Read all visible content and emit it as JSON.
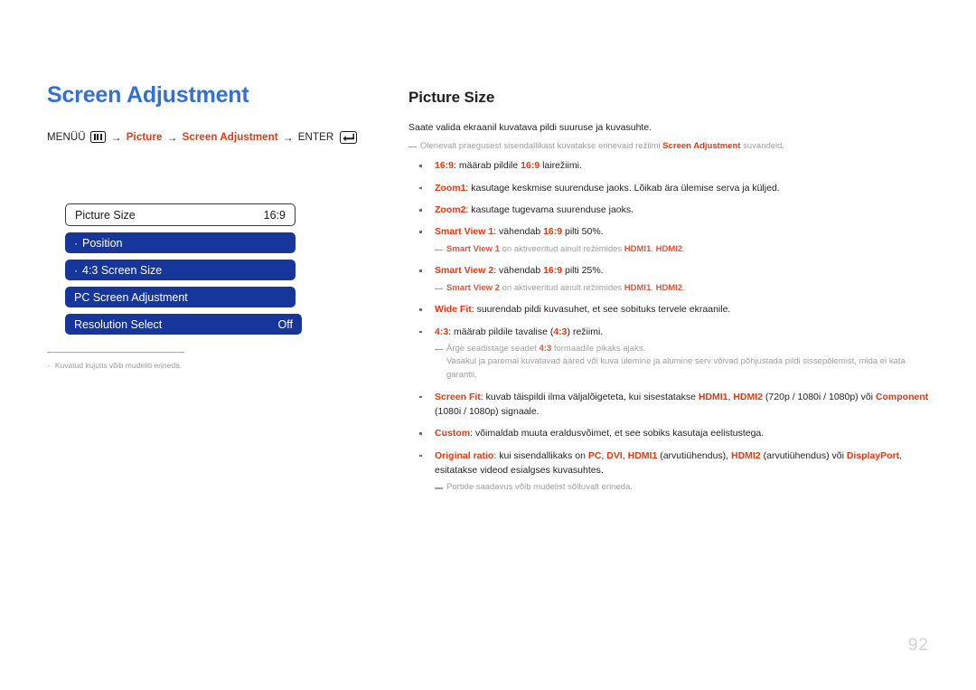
{
  "page": {
    "number": "92",
    "title": "Screen Adjustment"
  },
  "menu_path": {
    "prefix": "MENÜÜ",
    "menu_icon": "menu-key-icon",
    "arrow": "→",
    "item1": "Picture",
    "item2": "Screen Adjustment",
    "enter_label": "ENTER",
    "enter_icon": "enter-key-icon"
  },
  "osd": {
    "rows": [
      {
        "label": "Picture Size",
        "value": "16:9",
        "style": "selected",
        "dot": false
      },
      {
        "label": "Position",
        "value": "",
        "style": "blue",
        "dot": true
      },
      {
        "label": "4:3 Screen Size",
        "value": "",
        "style": "blue",
        "dot": true
      },
      {
        "label": "PC Screen Adjustment",
        "value": "",
        "style": "blue",
        "dot": false
      },
      {
        "label": "Resolution Select",
        "value": "Off",
        "style": "blue wide",
        "dot": false
      }
    ]
  },
  "left_note": {
    "dash": "-",
    "text": "Kuvatud kujutis võib mudeliti erineda."
  },
  "content": {
    "section_title": "Picture Size",
    "intro": "Saate valida ekraanil kuvatava pildi suuruse ja kuvasuhte.",
    "intro_note": {
      "pre": "Olenevalt praegusest sisendallikast kuvatakse erinevaid režiimi ",
      "term": "Screen Adjustment",
      "post": " suvandeid."
    },
    "bullets": [
      {
        "term": "16:9",
        "sep": ": ",
        "pre": "määrab pildile ",
        "term2": "16:9",
        "post": " lairežiimi."
      },
      {
        "term": "Zoom1",
        "sep": ": ",
        "pre": "kasutage keskmise suurenduse jaoks. Lõikab ära ülemise serva ja küljed.",
        "term2": "",
        "post": ""
      },
      {
        "term": "Zoom2",
        "sep": ": ",
        "pre": "kasutage tugevama suurenduse jaoks.",
        "term2": "",
        "post": ""
      },
      {
        "term": "Smart View 1",
        "sep": ": ",
        "pre": "vähendab ",
        "term2": "16:9",
        "post": " pilti 50%.",
        "note": {
          "term": "Smart View 1",
          "mid": " on aktiveeritud ainult režiimides ",
          "term_a": "HDMI1",
          "comma": ", ",
          "term_b": "HDMI2",
          "end": "."
        }
      },
      {
        "term": "Smart View 2",
        "sep": ": ",
        "pre": "vähendab ",
        "term2": "16:9",
        "post": " pilti 25%.",
        "note": {
          "term": "Smart View 2",
          "mid": " on aktiveeritud ainult režiimides ",
          "term_a": "HDMI1",
          "comma": ", ",
          "term_b": "HDMI2",
          "end": "."
        }
      },
      {
        "term": "Wide Fit",
        "sep": ": ",
        "pre": "suurendab pildi kuvasuhet, et see sobituks tervele ekraanile.",
        "term2": "",
        "post": ""
      },
      {
        "term": "4:3",
        "sep": ": ",
        "pre": "määrab pildile tavalise (",
        "term2": "4:3",
        "post": ") režiimi.",
        "note2": {
          "pre": "Ärge seadistage seadet ",
          "term": "4:3",
          "post": " formaadile pikaks ajaks.",
          "cont": "Vasakul ja paremal kuvatavad ääred või kuva ülemine ja alumine serv võivad põhjustada pildi sissepõlemist, mida ei kata garantii."
        }
      },
      {
        "term": "Screen Fit",
        "sep": ": ",
        "pre": "kuvab täispildi ilma väljalõigeteta, kui sisestatakse ",
        "term_a": "HDMI1",
        "comma": ", ",
        "term_b": "HDMI2",
        "mid": " (720p / 1080i / 1080p) või ",
        "term_c": "Component",
        "post": " (1080i / 1080p) signaale."
      },
      {
        "term": "Custom",
        "sep": ": ",
        "pre": "võimaldab muuta eraldusvõimet, et see sobiks kasutaja eelistustega.",
        "term2": "",
        "post": ""
      },
      {
        "term": "Original ratio",
        "sep": ": ",
        "pre": "kui sisendallikaks on ",
        "term_a": "PC",
        "comma": ", ",
        "term_b": "DVI",
        "comma2": ", ",
        "term_c": "HDMI1",
        "mid": " (arvutiühendus), ",
        "term_d": "HDMI2",
        "mid2": " (arvutiühendus) või ",
        "term_e": "DisplayPort",
        "post": ", esitatakse videod esialgses kuvasuhtes.",
        "note3": "Portide saadavus võib mudelist sõltuvalt erineda."
      }
    ]
  },
  "colors": {
    "title_blue": "#3371cf",
    "osd_blue": "#16369b",
    "accent_red": "#e8380d",
    "muted_gray": "#a0a0a0",
    "page_num_gray": "#d2d2d2"
  }
}
